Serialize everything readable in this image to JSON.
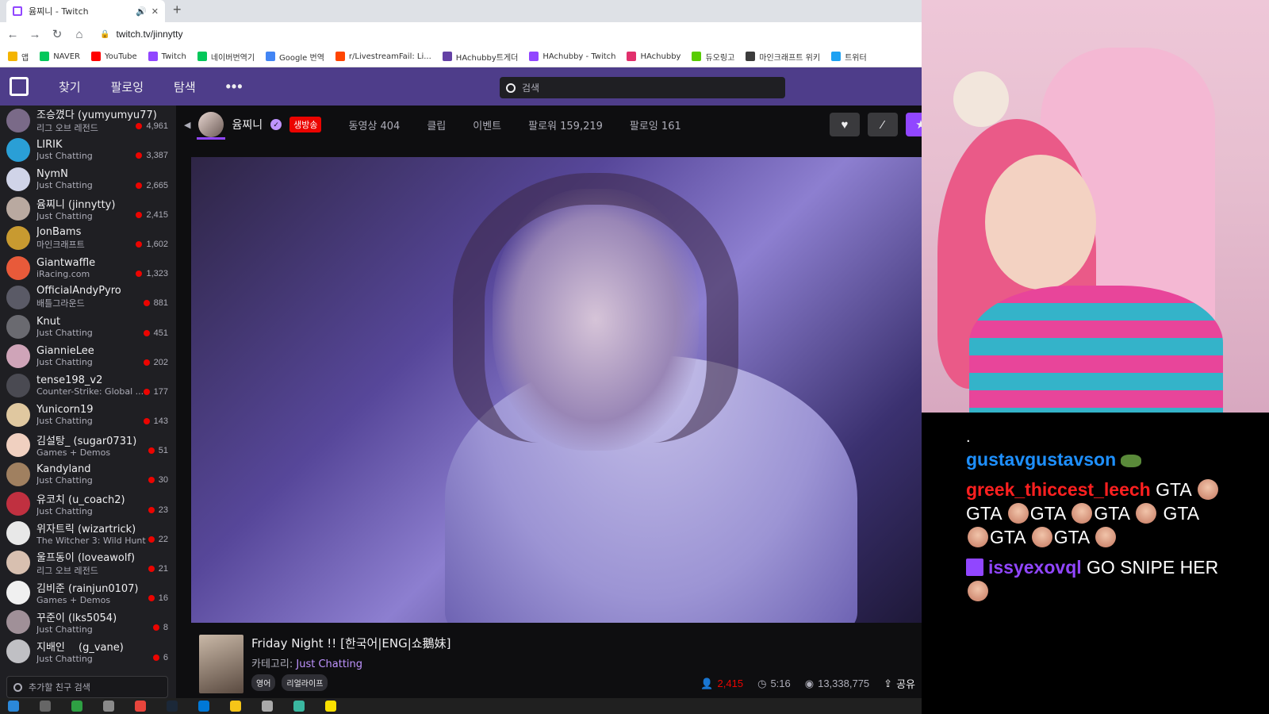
{
  "browser": {
    "tab_title": "윰찌니 - Twitch",
    "new_tab": "+",
    "url": "twitch.tv/jinnytty",
    "bookmarks": [
      {
        "label": "앱",
        "color": "#f4b400"
      },
      {
        "label": "NAVER",
        "color": "#03c75a"
      },
      {
        "label": "YouTube",
        "color": "#ff0000"
      },
      {
        "label": "Twitch",
        "color": "#9146ff"
      },
      {
        "label": "네이버번역기",
        "color": "#03c75a"
      },
      {
        "label": "Google 번역",
        "color": "#4285f4"
      },
      {
        "label": "r/LivestreamFail: Li...",
        "color": "#ff4500"
      },
      {
        "label": "HAchubby트게더",
        "color": "#6441a5"
      },
      {
        "label": "HAchubby - Twitch",
        "color": "#9146ff"
      },
      {
        "label": "HAchubby",
        "color": "#e1306c"
      },
      {
        "label": "듀오링고",
        "color": "#58cc02"
      },
      {
        "label": "마인크래프트 위키",
        "color": "#3c3c3c"
      },
      {
        "label": "트위터",
        "color": "#1da1f2"
      }
    ]
  },
  "twitch_nav": {
    "find": "찾기",
    "following": "팔로잉",
    "explore": "탐색",
    "more": "•••",
    "search_placeholder": "검색"
  },
  "sidebar": {
    "channels": [
      {
        "name": "조승꼈다 (yumyumyu77)",
        "category": "리그 오브 레전드",
        "viewers": "4,961",
        "avatar": "#7a6a88"
      },
      {
        "name": "LIRIK",
        "category": "Just Chatting",
        "viewers": "3,387",
        "avatar": "#2a9fd6"
      },
      {
        "name": "NymN",
        "category": "Just Chatting",
        "viewers": "2,665",
        "avatar": "#d0d4e8"
      },
      {
        "name": "윰찌니 (jinnytty)",
        "category": "Just Chatting",
        "viewers": "2,415",
        "avatar": "#b9a9a0"
      },
      {
        "name": "JonBams",
        "category": "마인크래프트",
        "viewers": "1,602",
        "avatar": "#c89a30"
      },
      {
        "name": "Giantwaffle",
        "category": "iRacing.com",
        "viewers": "1,323",
        "avatar": "#e85a3a"
      },
      {
        "name": "OfficialAndyPyro",
        "category": "배틀그라운드",
        "viewers": "881",
        "avatar": "#5a5a66"
      },
      {
        "name": "Knut",
        "category": "Just Chatting",
        "viewers": "451",
        "avatar": "#6a6a70"
      },
      {
        "name": "GiannieLee",
        "category": "Just Chatting",
        "viewers": "202",
        "avatar": "#cfa4b8"
      },
      {
        "name": "tense198_v2",
        "category": "Counter-Strike: Global ...",
        "viewers": "177",
        "avatar": "#4a4a52"
      },
      {
        "name": "Yunicorn19",
        "category": "Just Chatting",
        "viewers": "143",
        "avatar": "#e0c8a0"
      },
      {
        "name": "김설탕_ (sugar0731)",
        "category": "Games + Demos",
        "viewers": "51",
        "avatar": "#f0d0c0"
      },
      {
        "name": "Kandyland",
        "category": "Just Chatting",
        "viewers": "30",
        "avatar": "#a08060"
      },
      {
        "name": "유코치 (u_coach2)",
        "category": "Just Chatting",
        "viewers": "23",
        "avatar": "#c03040"
      },
      {
        "name": "위자트릭 (wizartrick)",
        "category": "The Witcher 3: Wild Hunt",
        "viewers": "22",
        "avatar": "#e8e8e8"
      },
      {
        "name": "울프동이 (loveawolf)",
        "category": "리그 오브 레전드",
        "viewers": "21",
        "avatar": "#d8c0b0"
      },
      {
        "name": "김비준 (rainjun0107)",
        "category": "Games + Demos",
        "viewers": "16",
        "avatar": "#f0f0f0"
      },
      {
        "name": "꾸준이 (lks5054)",
        "category": "Just Chatting",
        "viewers": "8",
        "avatar": "#a09098"
      },
      {
        "name": "지배인 　(g_vane)",
        "category": "Just Chatting",
        "viewers": "6",
        "avatar": "#c0c0c4"
      }
    ],
    "friend_search_placeholder": "추가할 친구 검색"
  },
  "channel": {
    "name": "윰찌니",
    "live_badge": "생방송",
    "tabs": [
      "동영상 404",
      "클립",
      "이벤트",
      "팔로워 159,219",
      "팔로잉 161"
    ]
  },
  "stream": {
    "title": "Friday Night !! [한국어|ENG|쇼鵝妹]",
    "category_label": "카테고리:",
    "category": "Just Chatting",
    "tags": [
      "영어",
      "리얼라이프"
    ],
    "viewers": "2,415",
    "uptime": "5:16",
    "total_views": "13,338,775",
    "share": "공유"
  },
  "chat": {
    "dot": ".",
    "messages": [
      {
        "user": "gustavgustavson",
        "text": ""
      },
      {
        "user": "greek_thiccest_leech",
        "text_parts": [
          "GTA",
          "GTA",
          "GTA",
          "GTA",
          "GTA",
          "GTA",
          "GTA"
        ]
      },
      {
        "user": "issyexovql",
        "text": "GO SNIPE HER"
      }
    ]
  }
}
